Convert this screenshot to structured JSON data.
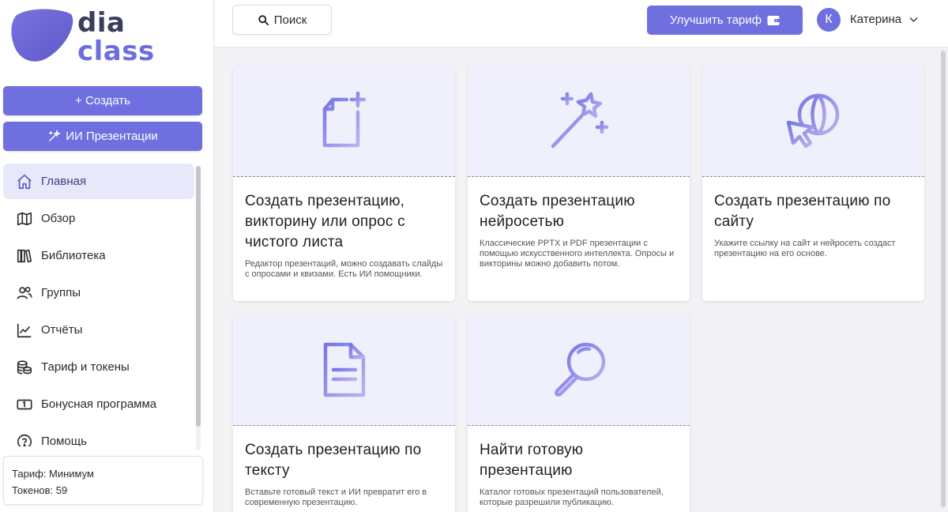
{
  "logo": {
    "line1": "dia",
    "line2": "class"
  },
  "sidebar": {
    "create_label": "+ Создать",
    "ai_label": "ИИ Презентации",
    "items": [
      {
        "label": "Главная",
        "icon": "home-icon",
        "active": true
      },
      {
        "label": "Обзор",
        "icon": "map-icon"
      },
      {
        "label": "Библиотека",
        "icon": "library-icon"
      },
      {
        "label": "Группы",
        "icon": "users-icon"
      },
      {
        "label": "Отчёты",
        "icon": "chart-icon"
      },
      {
        "label": "Тариф и токены",
        "icon": "coins-icon"
      },
      {
        "label": "Бонусная программа",
        "icon": "ticket-icon"
      },
      {
        "label": "Помощь",
        "icon": "help-icon"
      }
    ],
    "tariff": "Тариф: Минимум",
    "tokens": "Токенов: 59"
  },
  "header": {
    "search_label": "Поиск",
    "upgrade_label": "Улучшить тариф",
    "avatar_letter": "К",
    "user_name": "Катерина"
  },
  "cards": [
    {
      "title": "Создать презентацию, викторину или опрос с чистого листа",
      "desc": "Редактор презентаций, можно создавать слайды с опросами и квизами. Есть ИИ помощники.",
      "icon": "new-file-icon"
    },
    {
      "title": "Создать презентацию нейросетью",
      "desc": "Классические PPTX и PDF презентации с помощью искусственного интеллекта. Опросы и викторины можно добавить потом.",
      "icon": "magic-wand-icon"
    },
    {
      "title": "Создать презентацию по сайту",
      "desc": "Укажите ссылку на сайт и нейросеть создаст презентацию на его основе.",
      "icon": "globe-cursor-icon"
    },
    {
      "title": "Создать презентацию по тексту",
      "desc": "Вставьте готовый текст и ИИ превратит его в современную презентацию.",
      "icon": "document-icon"
    },
    {
      "title": "Найти готовую презентацию",
      "desc": "Каталог готовых презентаций пользователей, которые разрешили публикацию.",
      "icon": "magnifier-icon"
    }
  ],
  "colors": {
    "accent": "#6f6fe0",
    "card_top_bg": "#f0f0fd",
    "active_nav_bg": "#e8e8fb"
  }
}
